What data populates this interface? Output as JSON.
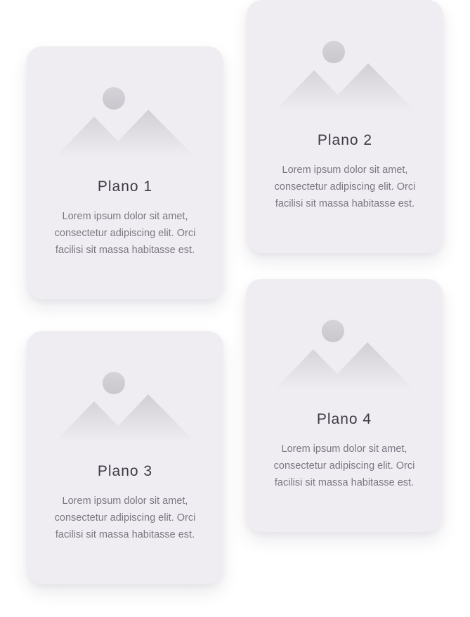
{
  "cards": [
    {
      "title": "Plano 1",
      "description": "Lorem ipsum dolor sit amet, consectetur adipiscing elit. Orci facilisi sit massa habitasse est.",
      "image_icon": "image-placeholder-icon"
    },
    {
      "title": "Plano 2",
      "description": "Lorem ipsum dolor sit amet, consectetur adipiscing elit. Orci facilisi sit massa habitasse est.",
      "image_icon": "image-placeholder-icon"
    },
    {
      "title": "Plano 3",
      "description": "Lorem ipsum dolor sit amet, consectetur adipiscing elit. Orci facilisi sit massa habitasse est.",
      "image_icon": "image-placeholder-icon"
    },
    {
      "title": "Plano 4",
      "description": "Lorem ipsum dolor sit amet, consectetur adipiscing elit. Orci facilisi sit massa habitasse est.",
      "image_icon": "image-placeholder-icon"
    }
  ],
  "colors": {
    "background": "#ffffff",
    "card_background": "#efedf2",
    "title_text": "#3d3a44",
    "body_text": "#7b7883",
    "placeholder_shape": "#d3d1d6"
  }
}
